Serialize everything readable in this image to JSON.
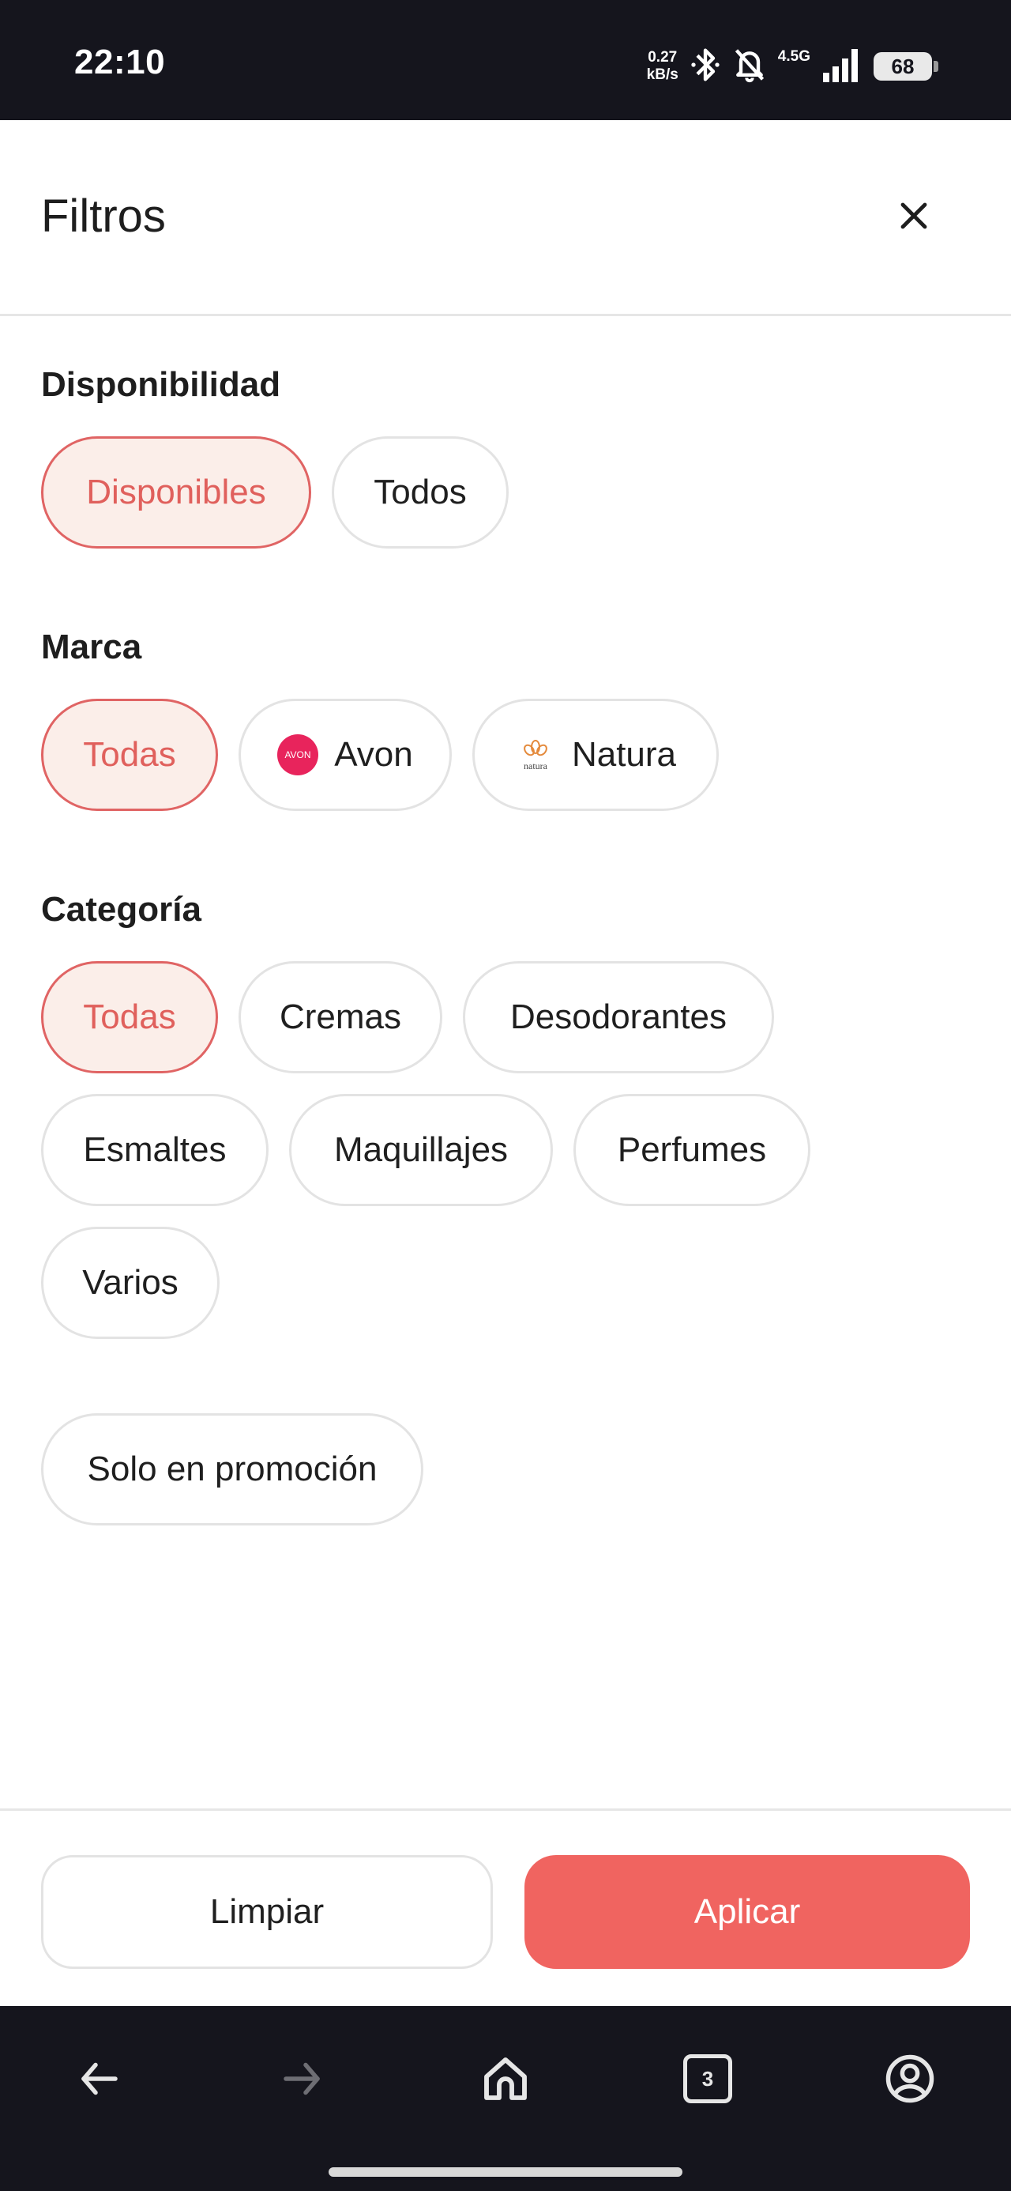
{
  "status_bar": {
    "time": "22:10",
    "net_speed_value": "0.27",
    "net_speed_unit": "kB/s",
    "network_type": "4.5G",
    "battery": "68",
    "icons": [
      "bluetooth-icon",
      "bell-muted-icon",
      "signal-icon",
      "battery-icon"
    ]
  },
  "header": {
    "title": "Filtros",
    "close_icon": "close-icon"
  },
  "sections": {
    "availability": {
      "title": "Disponibilidad",
      "options": [
        {
          "label": "Disponibles",
          "selected": true
        },
        {
          "label": "Todos",
          "selected": false
        }
      ]
    },
    "brand": {
      "title": "Marca",
      "options": [
        {
          "label": "Todas",
          "selected": true
        },
        {
          "label": "Avon",
          "selected": false,
          "logo_text": "AVON"
        },
        {
          "label": "Natura",
          "selected": false,
          "logo_text": "natura"
        }
      ]
    },
    "category": {
      "title": "Categoría",
      "options": [
        {
          "label": "Todas",
          "selected": true
        },
        {
          "label": "Cremas",
          "selected": false
        },
        {
          "label": "Desodorantes",
          "selected": false
        },
        {
          "label": "Esmaltes",
          "selected": false
        },
        {
          "label": "Maquillajes",
          "selected": false
        },
        {
          "label": "Perfumes",
          "selected": false
        },
        {
          "label": "Varios",
          "selected": false
        }
      ]
    },
    "promo": {
      "label": "Solo en promoción",
      "selected": false
    }
  },
  "footer": {
    "clear_label": "Limpiar",
    "apply_label": "Aplicar"
  },
  "nav_bar": {
    "tab_count": "3"
  },
  "colors": {
    "accent": "#f06460",
    "selected_bg": "#fbeee9",
    "selected_text": "#e0605c",
    "dark": "#15151d"
  }
}
